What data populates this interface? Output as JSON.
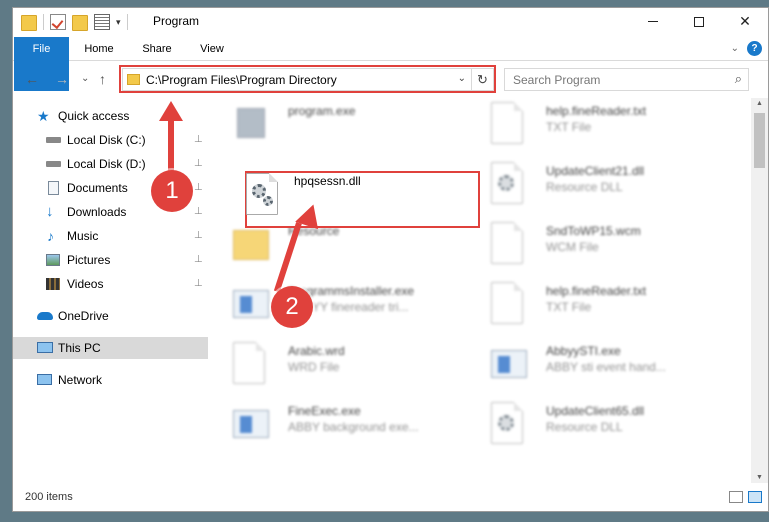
{
  "window": {
    "title": "Program",
    "controls": {
      "minimize": "minimize",
      "maximize": "maximize",
      "close": "✕"
    }
  },
  "ribbon": {
    "tabs": [
      "File",
      "Home",
      "Share",
      "View"
    ],
    "help": "?",
    "collapse": "⌄"
  },
  "address": {
    "path": "C:\\Program Files\\Program Directory",
    "dropdown": "⌄",
    "refresh": "↻"
  },
  "search": {
    "placeholder": "Search Program",
    "icon": "⌕"
  },
  "nav": {
    "back": "←",
    "forward": "→",
    "recent": "⌄",
    "up": "↑"
  },
  "sidebar": {
    "items": [
      {
        "label": "Quick access",
        "icon": "star-icon"
      },
      {
        "label": "Local Disk (C:)",
        "icon": "drive-icon",
        "pinned": true
      },
      {
        "label": "Local Disk (D:)",
        "icon": "drive-icon",
        "pinned": true
      },
      {
        "label": "Documents",
        "icon": "document-icon",
        "pinned": true
      },
      {
        "label": "Downloads",
        "icon": "download-icon",
        "pinned": true
      },
      {
        "label": "Music",
        "icon": "music-icon",
        "pinned": true
      },
      {
        "label": "Pictures",
        "icon": "pictures-icon",
        "pinned": true
      },
      {
        "label": "Videos",
        "icon": "video-icon",
        "pinned": true
      },
      {
        "label": "OneDrive",
        "icon": "cloud-icon"
      },
      {
        "label": "This PC",
        "icon": "pc-icon",
        "selected": true
      },
      {
        "label": "Network",
        "icon": "network-icon"
      }
    ],
    "pin_glyph": "📌"
  },
  "files": {
    "left": [
      {
        "name": "program.exe",
        "type": "",
        "icon": "app-icon"
      },
      {
        "name": "hpqsessn.dll",
        "type": "",
        "icon": "dll-gear-icon"
      },
      {
        "name": "Resource",
        "type": "",
        "icon": "folder-icon"
      },
      {
        "name": "ProgrammsInstaller.exe",
        "type": "ABBYY finereader tri...",
        "icon": "app-icon"
      },
      {
        "name": "Arabic.wrd",
        "type": "WRD File",
        "icon": "file-icon"
      },
      {
        "name": "FineExec.exe",
        "type": "ABBY background exe...",
        "icon": "app-icon"
      }
    ],
    "right": [
      {
        "name": "help.fineReader.txt",
        "type": "TXT File",
        "icon": "file-icon"
      },
      {
        "name": "UpdateClient21.dll",
        "type": "Resource DLL",
        "icon": "dll-gear-icon"
      },
      {
        "name": "SndToWP15.wcm",
        "type": "WCM File",
        "icon": "file-icon"
      },
      {
        "name": "help.fineReader.txt",
        "type": "TXT File",
        "icon": "file-icon"
      },
      {
        "name": "AbbyySTI.exe",
        "type": "ABBY sti event hand...",
        "icon": "app-icon"
      },
      {
        "name": "UpdateClient65.dll",
        "type": "Resource DLL",
        "icon": "dll-gear-icon"
      }
    ]
  },
  "status": {
    "count": "200 items"
  },
  "annotations": {
    "step1": "1",
    "step2": "2"
  },
  "colors": {
    "accent": "#1979ca",
    "highlight": "#e0413c"
  }
}
